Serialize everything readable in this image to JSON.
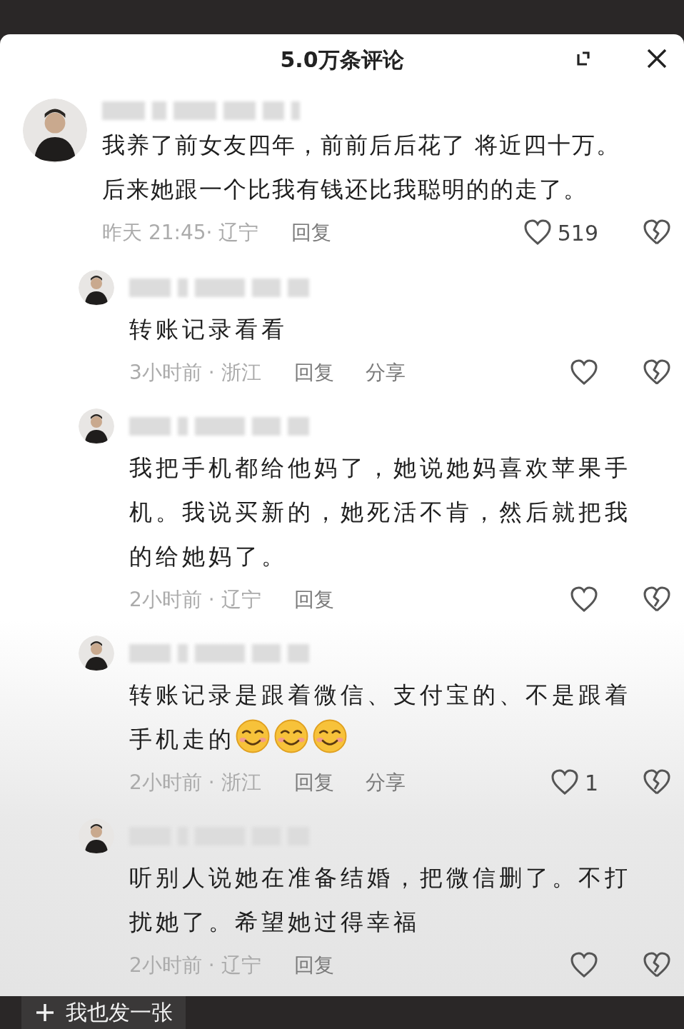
{
  "header": {
    "title": "5.0万条评论"
  },
  "comment": {
    "text": "我养了前女友四年，前前后后花了 将近四十万。后来她跟一个比我有钱还比我聪明的的走了。",
    "meta": "昨天 21:45· 辽宁",
    "actions": [
      "回复"
    ],
    "likes": "519",
    "replies": [
      {
        "kind": "plain",
        "text": "转账记录看看",
        "meta": "3小时前 · 浙江",
        "actions": [
          "回复",
          "分享"
        ]
      },
      {
        "kind": "plain",
        "text": "我把手机都给他妈了，她说她妈喜欢苹果手机。我说买新的，她死活不肯，然后就把我的给她妈了。",
        "meta": "2小时前 · 辽宁",
        "actions": [
          "回复"
        ]
      },
      {
        "kind": "emoji",
        "text": "转账记录是跟着微信、支付宝的、不是跟着手机走的",
        "meta": "2小时前 · 浙江",
        "actions": [
          "回复",
          "分享"
        ],
        "likes": "1"
      },
      {
        "kind": "plain",
        "text": "听别人说她在准备结婚，把微信删了。不打扰她了。希望她过得幸福",
        "meta": "2小时前 · 辽宁",
        "actions": [
          "回复"
        ]
      }
    ]
  },
  "bottom_bar": {
    "button": "我也发一张"
  }
}
